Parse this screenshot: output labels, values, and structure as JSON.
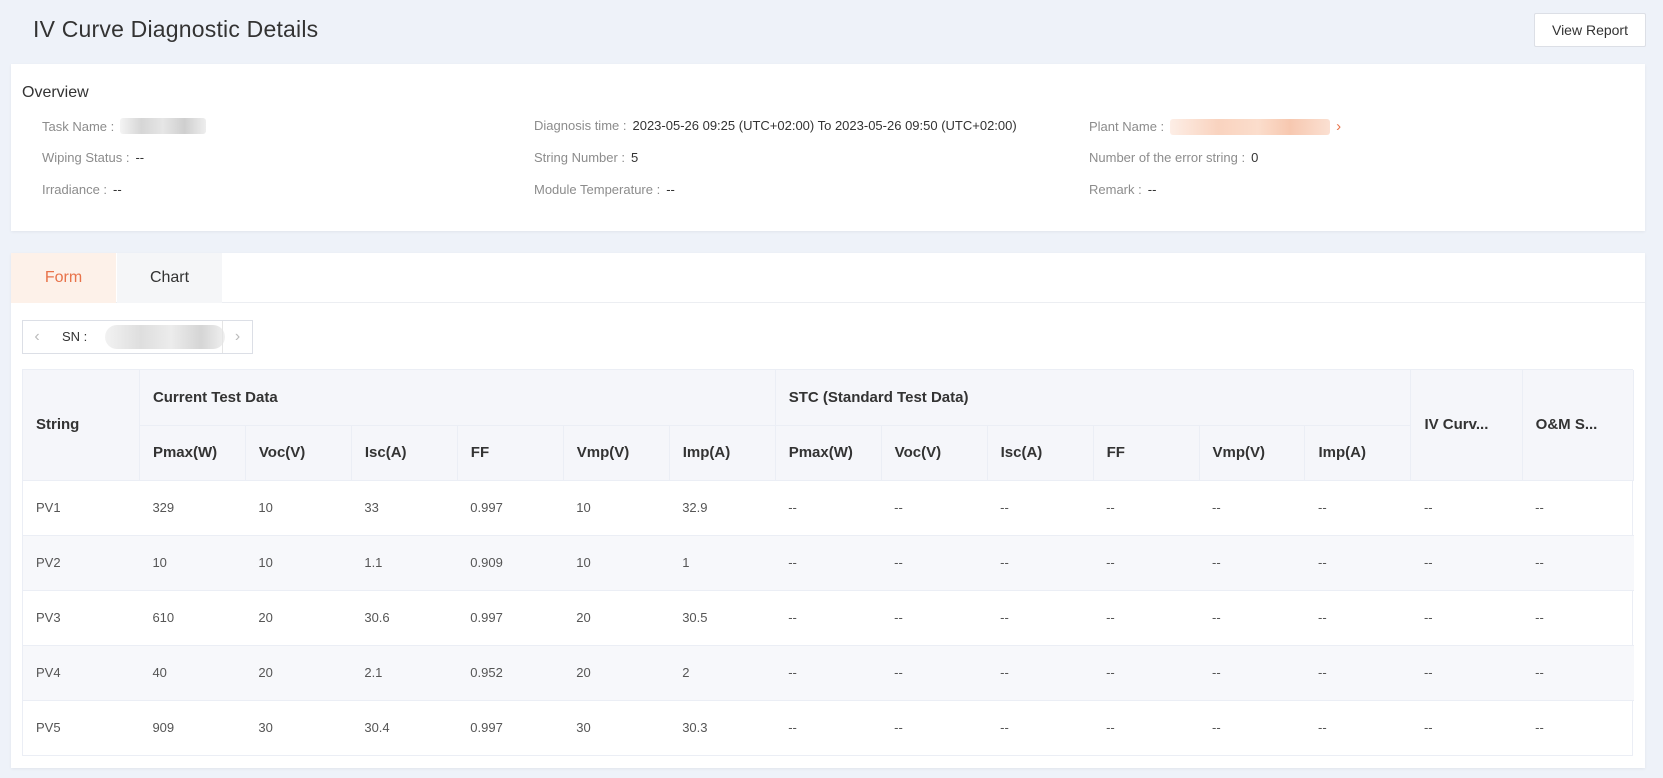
{
  "header": {
    "title": "IV Curve Diagnostic Details",
    "view_report_label": "View Report"
  },
  "overview": {
    "title": "Overview",
    "task_name_label": "Task Name :",
    "diagnosis_time_label": "Diagnosis time :",
    "diagnosis_time_value": "2023-05-26 09:25 (UTC+02:00) To 2023-05-26 09:50 (UTC+02:00)",
    "plant_name_label": "Plant Name :",
    "wiping_status_label": "Wiping Status :",
    "wiping_status_value": "--",
    "string_number_label": "String Number :",
    "string_number_value": "5",
    "error_string_label": "Number of the error string :",
    "error_string_value": "0",
    "irradiance_label": "Irradiance :",
    "irradiance_value": "--",
    "module_temp_label": "Module Temperature :",
    "module_temp_value": "--",
    "remark_label": "Remark :",
    "remark_value": "--"
  },
  "tabs": [
    {
      "label": "Form",
      "active": true
    },
    {
      "label": "Chart",
      "active": false
    }
  ],
  "sn": {
    "label": "SN :"
  },
  "table": {
    "string_header": "String",
    "group_current": "Current Test Data",
    "group_stc": "STC (Standard Test Data)",
    "iv_curve_header": "IV Curv...",
    "om_header": "O&M S...",
    "sub_headers": [
      "Pmax(W)",
      "Voc(V)",
      "Isc(A)",
      "FF",
      "Vmp(V)",
      "Imp(A)"
    ],
    "rows": [
      {
        "string": "PV1",
        "current": [
          "329",
          "10",
          "33",
          "0.997",
          "10",
          "32.9"
        ],
        "stc": [
          "--",
          "--",
          "--",
          "--",
          "--",
          "--"
        ],
        "iv": "--",
        "om": "--"
      },
      {
        "string": "PV2",
        "current": [
          "10",
          "10",
          "1.1",
          "0.909",
          "10",
          "1"
        ],
        "stc": [
          "--",
          "--",
          "--",
          "--",
          "--",
          "--"
        ],
        "iv": "--",
        "om": "--"
      },
      {
        "string": "PV3",
        "current": [
          "610",
          "20",
          "30.6",
          "0.997",
          "20",
          "30.5"
        ],
        "stc": [
          "--",
          "--",
          "--",
          "--",
          "--",
          "--"
        ],
        "iv": "--",
        "om": "--"
      },
      {
        "string": "PV4",
        "current": [
          "40",
          "20",
          "2.1",
          "0.952",
          "20",
          "2"
        ],
        "stc": [
          "--",
          "--",
          "--",
          "--",
          "--",
          "--"
        ],
        "iv": "--",
        "om": "--"
      },
      {
        "string": "PV5",
        "current": [
          "909",
          "30",
          "30.4",
          "0.997",
          "30",
          "30.3"
        ],
        "stc": [
          "--",
          "--",
          "--",
          "--",
          "--",
          "--"
        ],
        "iv": "--",
        "om": "--"
      }
    ]
  },
  "colors": {
    "accent": "#e8734a",
    "background": "#eef2f9",
    "table_header_bg": "#f5f6fa"
  }
}
